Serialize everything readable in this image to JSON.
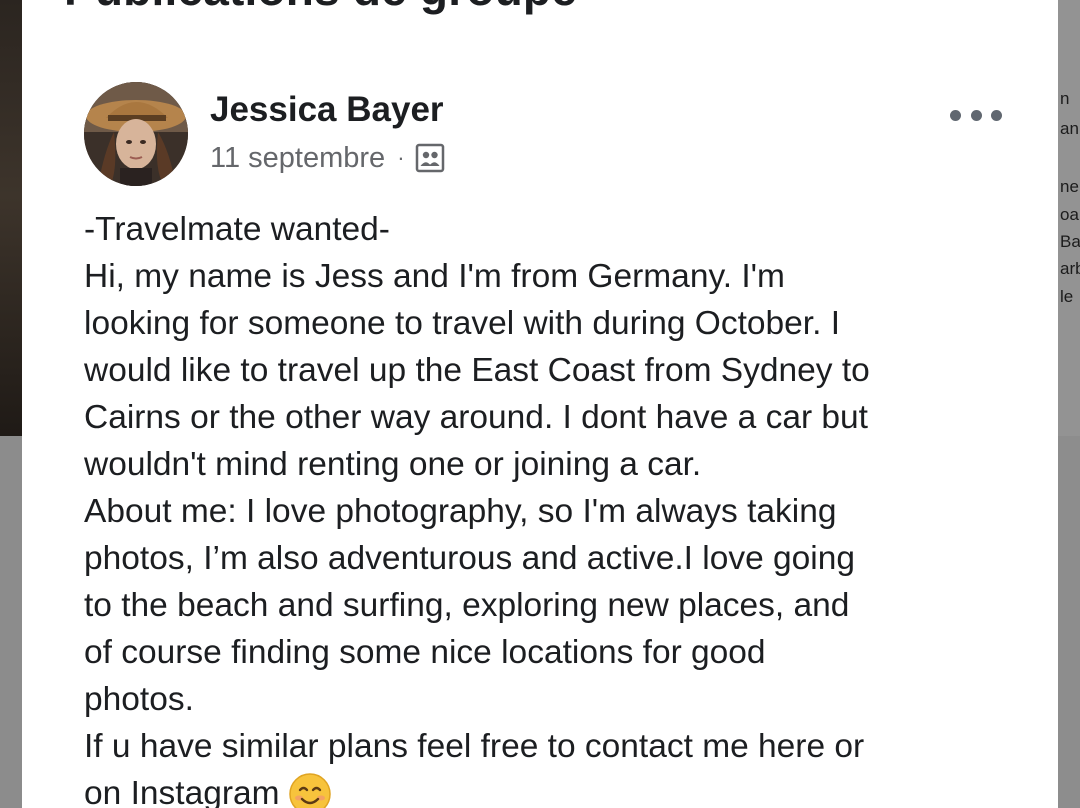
{
  "section": {
    "title": "Publications de groupe"
  },
  "post": {
    "author": "Jessica Bayer",
    "date": "11 septembre",
    "separator": "·",
    "audience_icon": "group-icon",
    "more_icon": "more-options-icon",
    "lines": [
      "-Travelmate wanted-",
      "Hi, my name is Jess and I'm from Germany. I'm",
      "looking for someone to travel with during October. I",
      "would like to travel up the East Coast from Sydney to",
      "Cairns or the other way around. I dont have a car but",
      "wouldn't mind renting one or joining a car.",
      "About me: I love photography, so I'm always taking",
      "photos, I’m also adventurous and active.I love going",
      "to the beach and surfing, exploring new places, and",
      "of course finding some nice locations for good",
      "photos.",
      "If u have similar plans feel free to contact me here or",
      "on Instagram"
    ],
    "emoji": "smiling-face-emoji"
  },
  "right_peek": {
    "lines": [
      "n",
      "an",
      "",
      "ne",
      "oa",
      "Ba",
      "arb",
      "le"
    ]
  },
  "colors": {
    "text_primary": "#1c1e21",
    "text_secondary": "#65676b",
    "card_background": "#ffffff",
    "backdrop": "#8a8a8a"
  }
}
